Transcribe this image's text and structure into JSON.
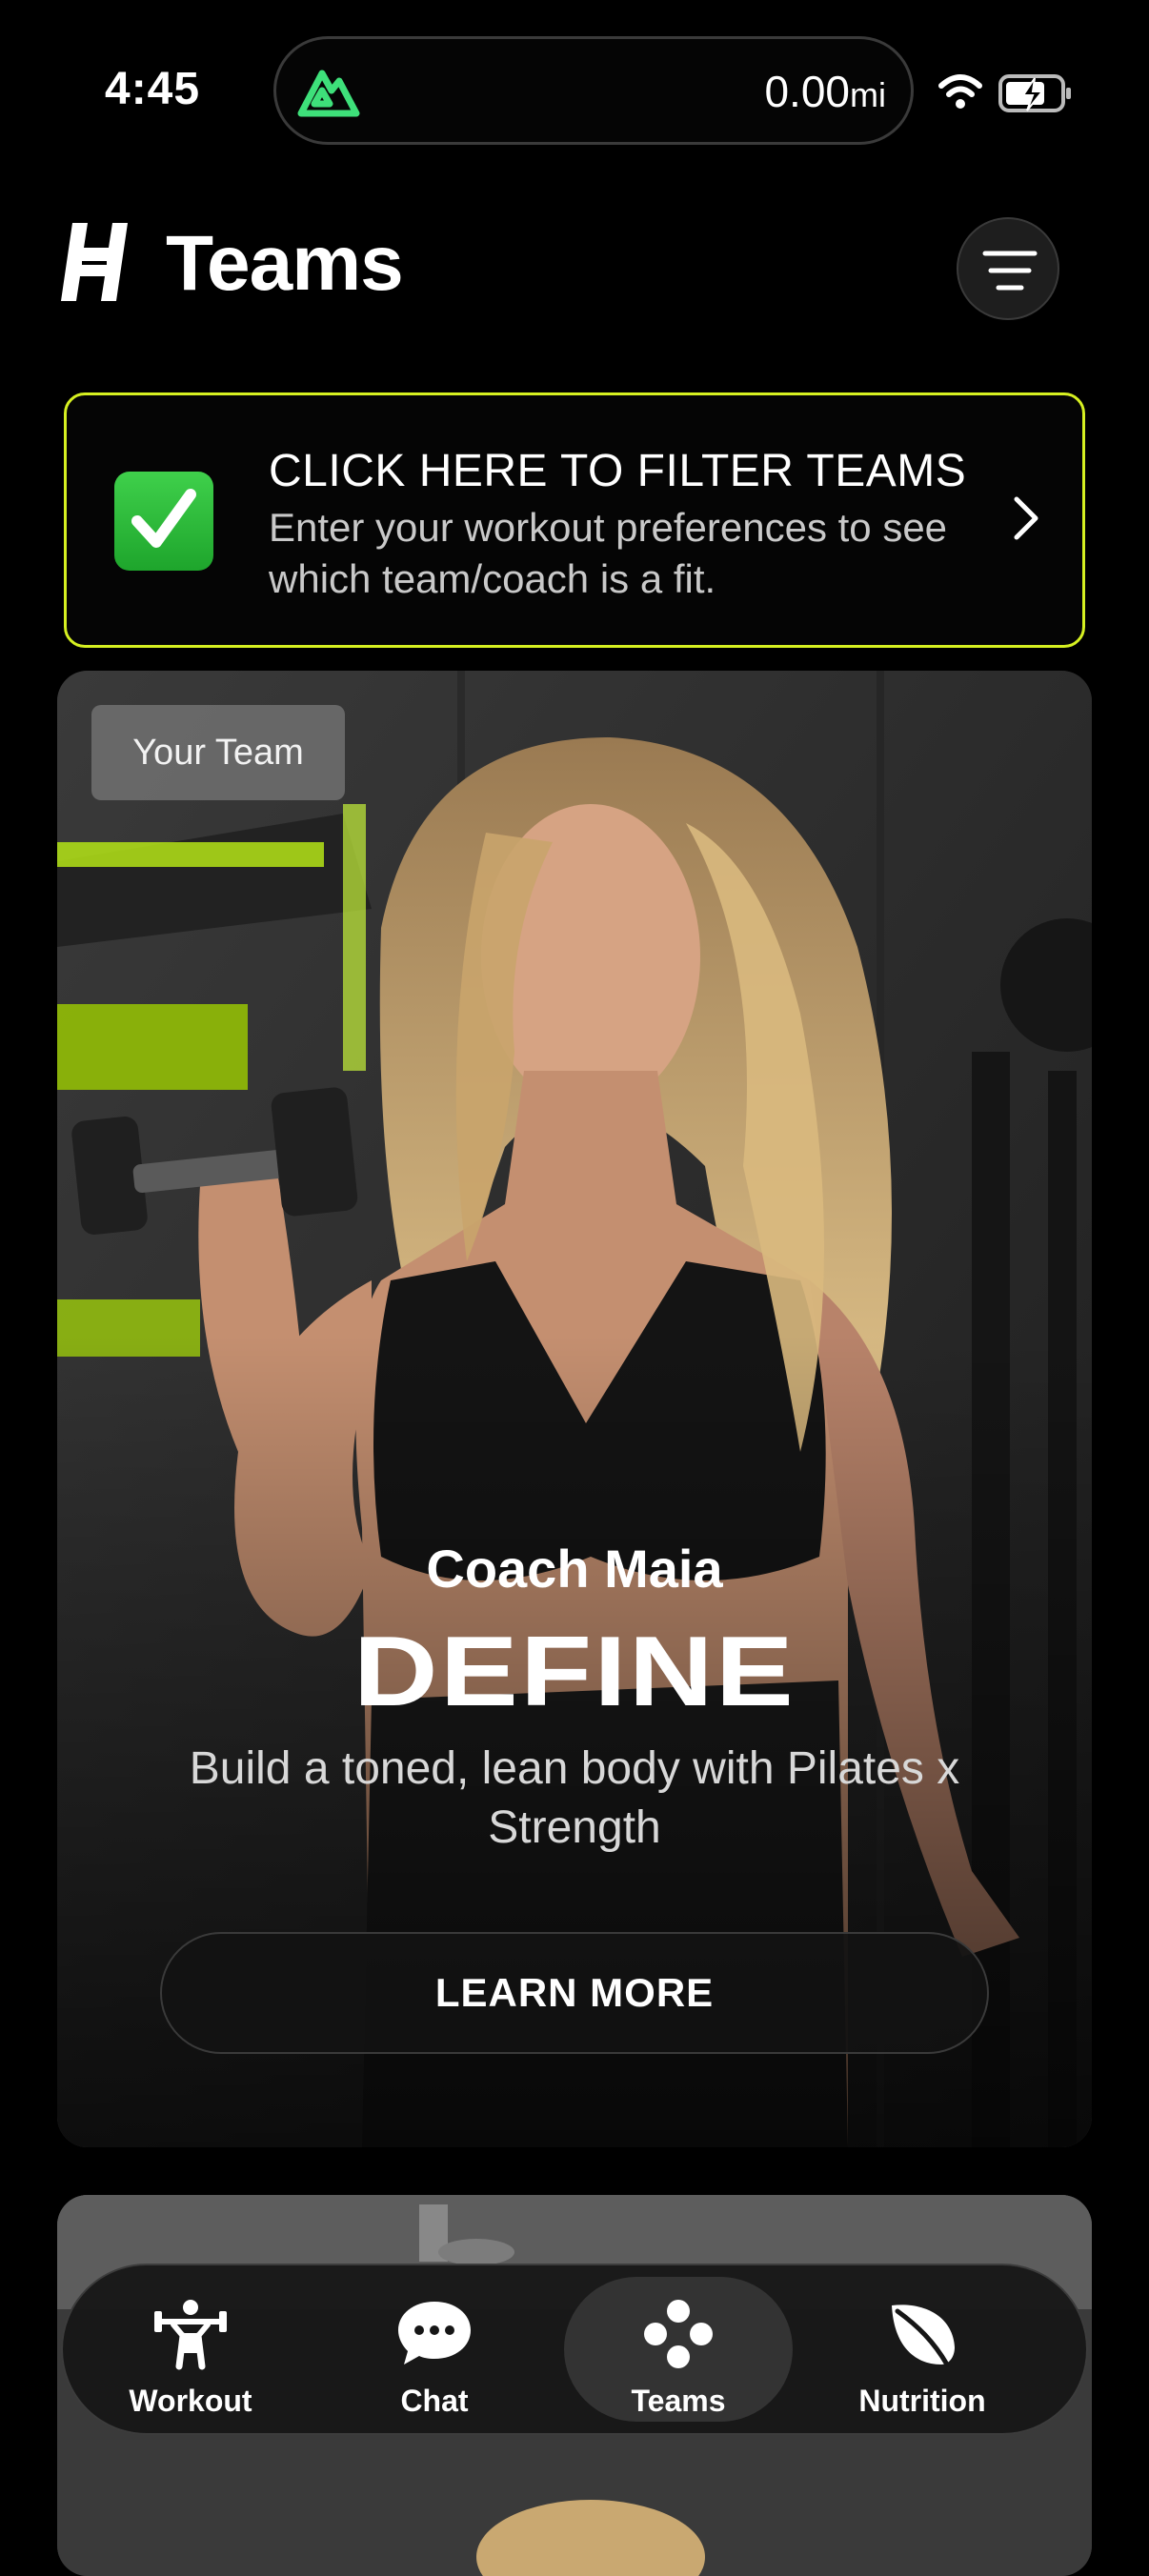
{
  "status_bar": {
    "time": "4:45",
    "activity_distance": "0.00",
    "activity_unit": "mi",
    "activity_icon": "mountain-icon",
    "icons": [
      "wifi-icon",
      "battery-charging-icon"
    ]
  },
  "header": {
    "logo": "brand-logo",
    "title": "Teams",
    "menu_icon": "filter-lines-icon"
  },
  "filter_banner": {
    "icon": "check-box-icon",
    "title": "CLICK HERE TO FILTER TEAMS",
    "subtitle": "Enter your workout preferences to see which team/coach is a fit.",
    "chevron": "chevron-right-icon",
    "border_color": "#d6f021"
  },
  "team_card": {
    "badge": "Your Team",
    "coach": "Coach Maia",
    "program": "DEFINE",
    "description": "Build a toned, lean body with Pilates x Strength",
    "cta": "LEARN MORE",
    "accent_color": "#b4e416"
  },
  "tab_bar": {
    "tabs": [
      {
        "label": "Workout",
        "icon": "weightlifter-icon",
        "active": false
      },
      {
        "label": "Chat",
        "icon": "chat-bubble-icon",
        "active": false
      },
      {
        "label": "Teams",
        "icon": "teams-dots-icon",
        "active": true
      },
      {
        "label": "Nutrition",
        "icon": "leaf-icon",
        "active": false
      }
    ]
  }
}
